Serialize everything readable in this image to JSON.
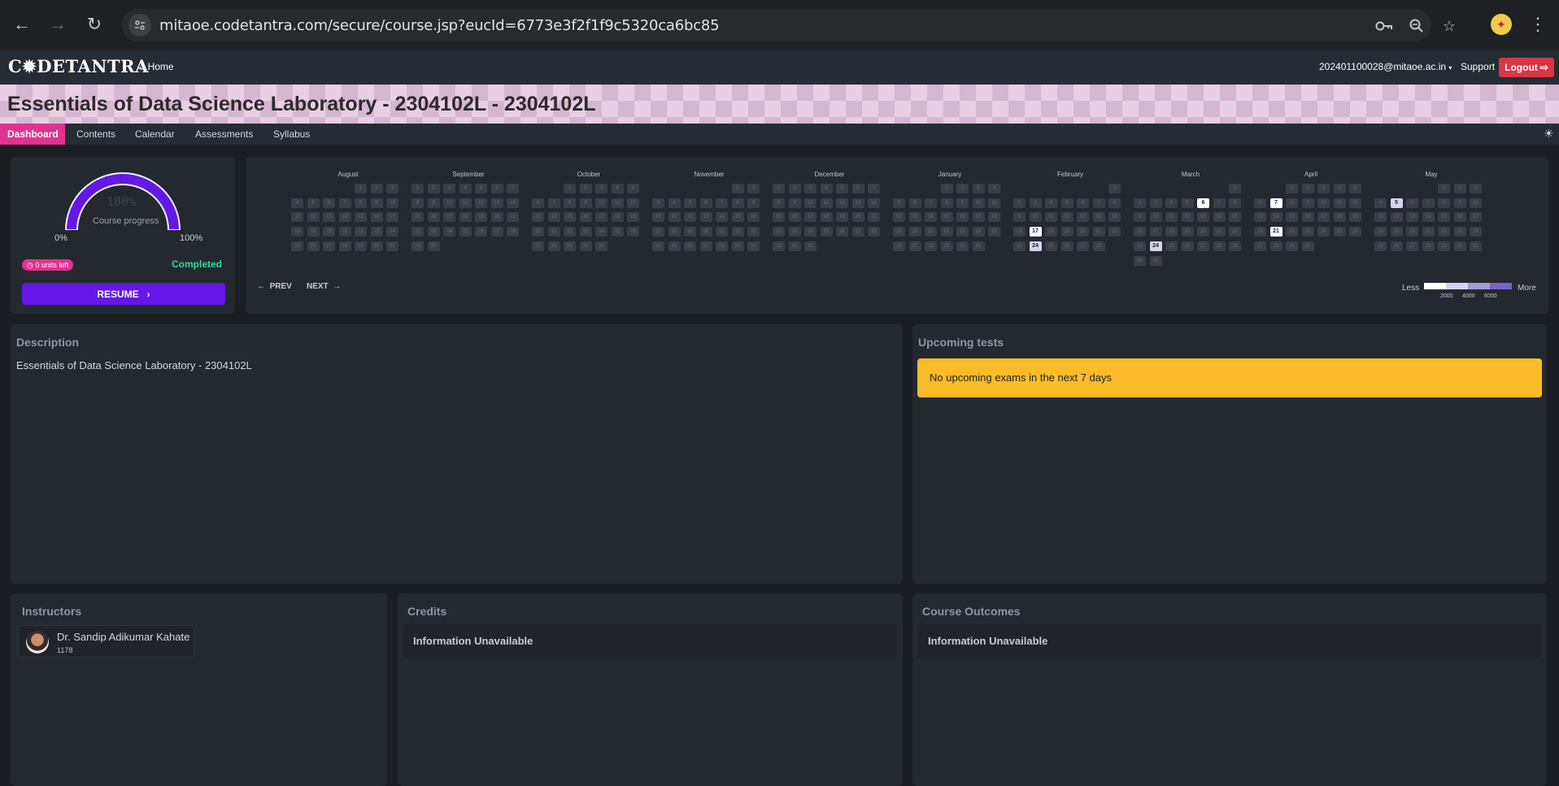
{
  "browser": {
    "url": "mitaoe.codetantra.com/secure/course.jsp?eucId=6773e3f2f1f9c5320ca6bc85"
  },
  "topbar": {
    "logo_text": "C✹DETANTRA",
    "home_label": "Home",
    "user_email": "202401100028@mitaoe.ac.in",
    "support_label": "Support",
    "logout_label": "Logout"
  },
  "page_title": "Essentials of Data Science Laboratory - 2304102L - 2304102L",
  "tabs": [
    {
      "label": "Dashboard",
      "active": true
    },
    {
      "label": "Contents"
    },
    {
      "label": "Calendar"
    },
    {
      "label": "Assessments"
    },
    {
      "label": "Syllabus"
    }
  ],
  "progress": {
    "value_percent": 100,
    "value_text": "100%",
    "caption": "Course progress",
    "min_label": "0%",
    "max_label": "100%",
    "units_left": "0 units left",
    "status": "Completed",
    "resume_label": "RESUME"
  },
  "heatmap": {
    "months": [
      {
        "name": "August",
        "start": 4,
        "days": 31
      },
      {
        "name": "September",
        "start": 0,
        "days": 30
      },
      {
        "name": "October",
        "start": 2,
        "days": 31
      },
      {
        "name": "November",
        "start": 5,
        "days": 30
      },
      {
        "name": "December",
        "start": 0,
        "days": 31
      },
      {
        "name": "January",
        "start": 3,
        "days": 31
      },
      {
        "name": "February",
        "start": 6,
        "days": 28
      },
      {
        "name": "March",
        "start": 6,
        "days": 31
      },
      {
        "name": "April",
        "start": 2,
        "days": 30
      },
      {
        "name": "May",
        "start": 4,
        "days": 31
      }
    ],
    "highlights": [
      {
        "month": "February",
        "day": 17,
        "level": 1
      },
      {
        "month": "February",
        "day": 24,
        "level": 2
      },
      {
        "month": "March",
        "day": 6,
        "level": 1
      },
      {
        "month": "March",
        "day": 24,
        "level": 2
      },
      {
        "month": "April",
        "day": 7,
        "level": 1
      },
      {
        "month": "April",
        "day": 21,
        "level": 1
      },
      {
        "month": "May",
        "day": 5,
        "level": 2
      }
    ],
    "prev_label": "PREV",
    "next_label": "NEXT",
    "legend_less": "Less",
    "legend_more": "More",
    "legend_ticks": [
      "2000",
      "4000",
      "6000"
    ]
  },
  "description": {
    "title": "Description",
    "text": "Essentials of Data Science Laboratory - 2304102L"
  },
  "upcoming": {
    "title": "Upcoming tests",
    "message": "No upcoming exams in the next 7 days"
  },
  "instructors": {
    "title": "Instructors",
    "items": [
      {
        "name": "Dr. Sandip Adikumar Kahate",
        "id": "1178"
      }
    ]
  },
  "credits": {
    "title": "Credits",
    "text": "Information Unavailable"
  },
  "outcomes": {
    "title": "Course Outcomes",
    "text": "Information Unavailable"
  },
  "colors": {
    "accent_pink": "#e0338f",
    "resume_purple": "#6417e6",
    "completed_green": "#3ad79b",
    "alert_yellow": "#fbbc2a",
    "logout_red": "#dc3545"
  }
}
